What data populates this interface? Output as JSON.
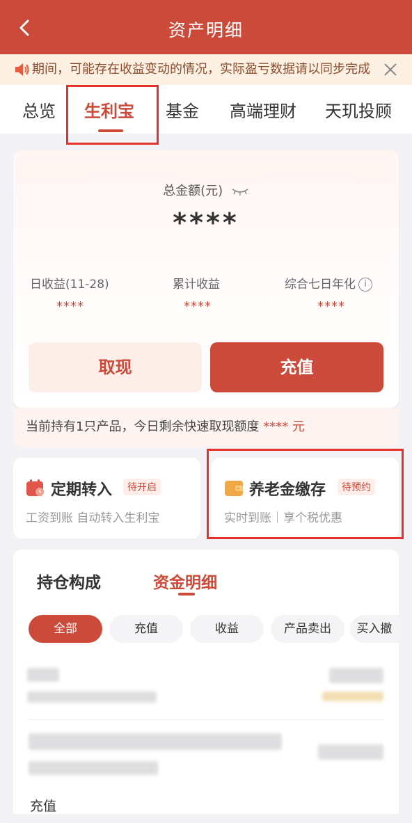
{
  "header": {
    "title": "资产明细",
    "back_icon": "chevron-left-icon"
  },
  "notice": {
    "text": "期间，可能存在收益变动的情况，实际盈亏数据请以同步完成",
    "speaker_icon": "speaker-icon",
    "close_icon": "close-icon"
  },
  "tabs": [
    {
      "label": "总览"
    },
    {
      "label": "生利宝",
      "active": true
    },
    {
      "label": "基金"
    },
    {
      "label": "高端理财"
    },
    {
      "label": "天玑投顾"
    }
  ],
  "summary": {
    "total_label": "总金额(元)",
    "total_value": "****",
    "stats": [
      {
        "label": "日收益(11-28)",
        "value": "****"
      },
      {
        "label": "累计收益",
        "value": "****"
      },
      {
        "label": "综合七日年化",
        "value": "****",
        "info": "i"
      }
    ],
    "withdraw_label": "取现",
    "recharge_label": "充值"
  },
  "holding_bar": {
    "text": "当前持有1只产品，今日剩余快速取现额度",
    "amount": "****",
    "unit": "元"
  },
  "promo": [
    {
      "title": "定期转入",
      "badge": "待开启",
      "subtitle": "工资到账 自动转入生利宝",
      "icon": "calendar-icon"
    },
    {
      "title": "养老金缴存",
      "badge": "待预约",
      "subtitle": "实时到账｜享个税优惠",
      "icon": "wallet-icon"
    }
  ],
  "detail": {
    "tabs": [
      {
        "label": "持仓构成"
      },
      {
        "label": "资金明细",
        "active": true
      }
    ],
    "filters": [
      {
        "label": "全部",
        "active": true
      },
      {
        "label": "充值"
      },
      {
        "label": "收益"
      },
      {
        "label": "产品卖出"
      },
      {
        "label": "买入撤"
      }
    ],
    "last_row_text": "充值"
  },
  "colors": {
    "brand": "#cc4a3a",
    "notice_bg": "#fdf1e3",
    "highlight_box": "#e8302a"
  }
}
